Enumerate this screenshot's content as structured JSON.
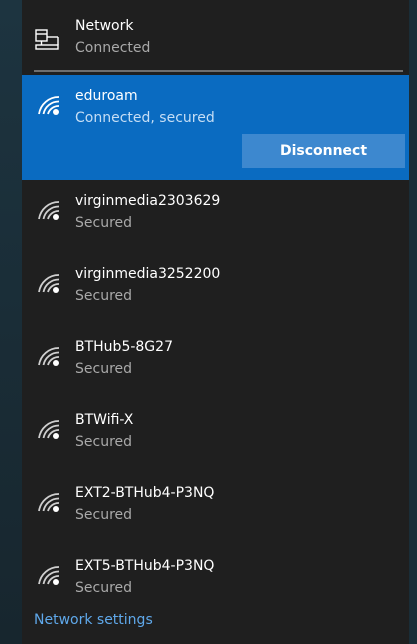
{
  "header": {
    "title": "Network",
    "status": "Connected"
  },
  "networks": [
    {
      "ssid": "eduroam",
      "status": "Connected, secured",
      "action": "Disconnect"
    },
    {
      "ssid": "virginmedia2303629",
      "status": "Secured"
    },
    {
      "ssid": "virginmedia3252200",
      "status": "Secured"
    },
    {
      "ssid": "BTHub5-8G27",
      "status": "Secured"
    },
    {
      "ssid": "BTWifi-X",
      "status": "Secured"
    },
    {
      "ssid": "EXT2-BTHub4-P3NQ",
      "status": "Secured"
    },
    {
      "ssid": "EXT5-BTHub4-P3NQ",
      "status": "Secured"
    }
  ],
  "footer": {
    "link": "Network settings"
  },
  "icons": {
    "header": "wired-computer-icon",
    "network": "wifi-signal-icon"
  },
  "colors": {
    "accent": "#0a6bc1",
    "button": "#3d88cf",
    "link": "#5fa8ea",
    "panel": "#1f1f1f"
  }
}
